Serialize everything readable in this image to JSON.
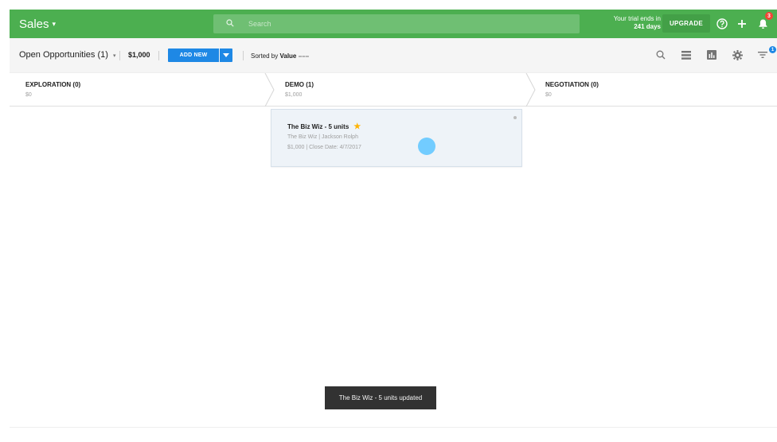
{
  "topbar": {
    "app_title": "Sales",
    "search_placeholder": "Search",
    "trial_line1": "Your trial ends in",
    "trial_line2": "241 days",
    "upgrade_label": "UPGRADE",
    "notification_count": "3",
    "accent_color": "#4caf50"
  },
  "toolbar": {
    "view_label": "Open Opportunities (1)",
    "total_value": "$1,000",
    "add_new_label": "ADD NEW",
    "sorted_prefix": "Sorted by ",
    "sorted_field": "Value",
    "filter_count": "1",
    "icons": [
      "search-icon",
      "list-view-icon",
      "chart-icon",
      "gear-icon",
      "filter-icon"
    ]
  },
  "stages": [
    {
      "name": "EXPLORATION (0)",
      "amount": "$0"
    },
    {
      "name": "DEMO (1)",
      "amount": "$1,000"
    },
    {
      "name": "NEGOTIATION (0)",
      "amount": "$0"
    }
  ],
  "card": {
    "title": "The Biz Wiz - 5 units",
    "subtitle": "The Biz Wiz | Jackson Rolph",
    "meta": "$1,000 | Close Date: 4/7/2017",
    "starred": true
  },
  "toast": {
    "message": "The Biz Wiz - 5 units updated"
  }
}
